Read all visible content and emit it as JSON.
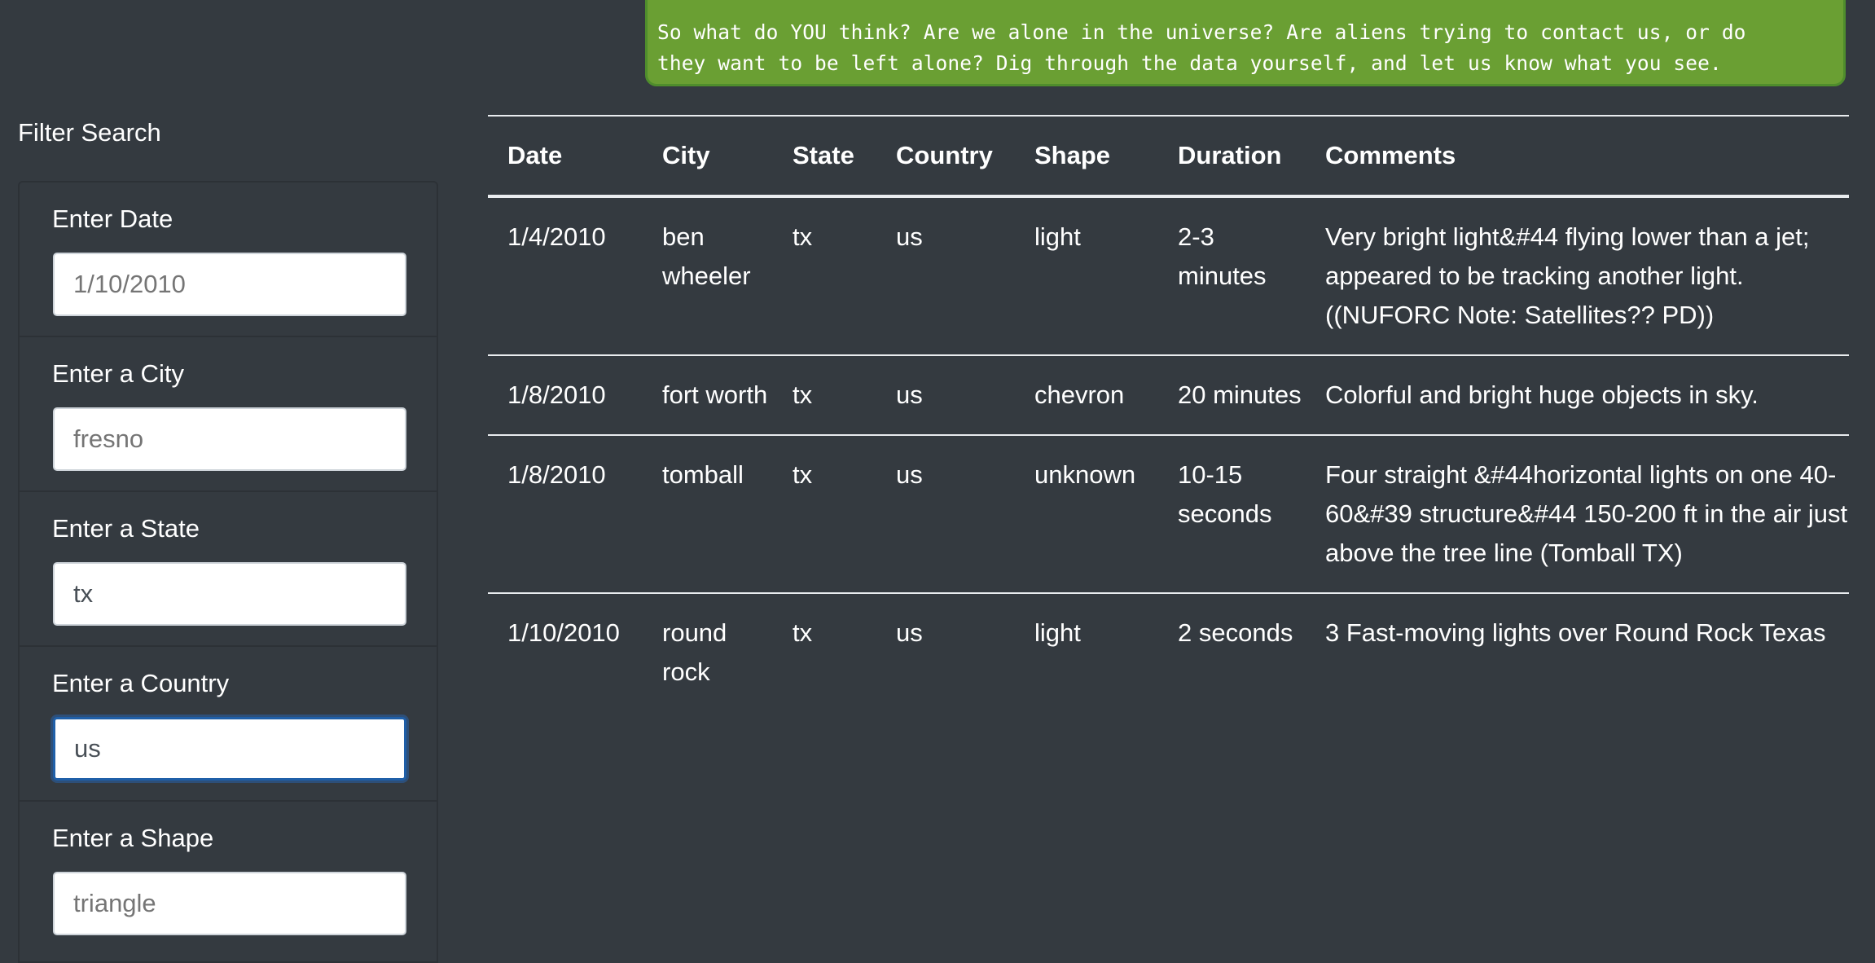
{
  "intro": {
    "text": "So what do YOU think? Are we alone in the universe? Are aliens trying to contact us, or do\nthey want to be left alone? Dig through the data yourself, and let us know what you see."
  },
  "filter": {
    "title": "Filter Search",
    "fields": [
      {
        "label": "Enter Date",
        "placeholder": "1/10/2010"
      },
      {
        "label": "Enter a City",
        "placeholder": "fresno"
      },
      {
        "label": "Enter a State",
        "value": "tx"
      },
      {
        "label": "Enter a Country",
        "value": "us"
      },
      {
        "label": "Enter a Shape",
        "placeholder": "triangle"
      }
    ]
  },
  "table": {
    "headers": [
      "Date",
      "City",
      "State",
      "Country",
      "Shape",
      "Duration",
      "Comments"
    ],
    "rows": [
      [
        "1/4/2010",
        "ben wheeler",
        "tx",
        "us",
        "light",
        "2-3 minutes",
        "Very bright light&#44 flying lower than a jet; appeared to be tracking another light. ((NUFORC Note: Satellites?? PD))"
      ],
      [
        "1/8/2010",
        "fort worth",
        "tx",
        "us",
        "chevron",
        "20 minutes",
        "Colorful and bright huge objects in sky."
      ],
      [
        "1/8/2010",
        "tomball",
        "tx",
        "us",
        "unknown",
        "10-15 seconds",
        "Four straight &#44horizontal lights on one 40-60&#39 structure&#44 150-200 ft in the air just above the tree line (Tomball TX)"
      ],
      [
        "1/10/2010",
        "round rock",
        "tx",
        "us",
        "light",
        "2 seconds",
        "3 Fast-moving lights over Round Rock Texas"
      ]
    ]
  },
  "colors": {
    "background": "#343a40",
    "intro_box": "#6a9f33",
    "focus_ring": "#1f5fa8"
  }
}
